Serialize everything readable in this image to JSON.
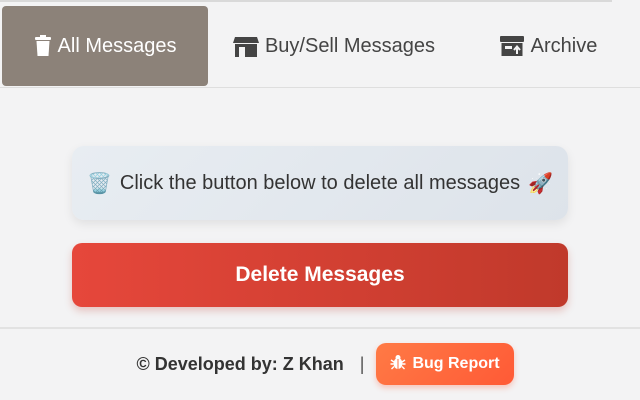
{
  "tabs": [
    {
      "label": "All Messages",
      "icon": "trash-icon",
      "active": true
    },
    {
      "label": "Buy/Sell Messages",
      "icon": "store-icon",
      "active": false
    },
    {
      "label": "Archive",
      "icon": "archive-icon",
      "active": false
    }
  ],
  "info": {
    "left_emoji": "🗑️",
    "text": "Click the button below to delete all messages",
    "right_emoji": "🚀"
  },
  "delete_button": {
    "label": "Delete Messages"
  },
  "footer": {
    "credit": "© Developed by: Z Khan",
    "separator": "|",
    "bug_button": {
      "label": "Bug Report",
      "icon": "bug-icon"
    }
  },
  "colors": {
    "active_tab": "#8c8279",
    "delete": "#e6473b",
    "bug": "#ff6b3d"
  }
}
